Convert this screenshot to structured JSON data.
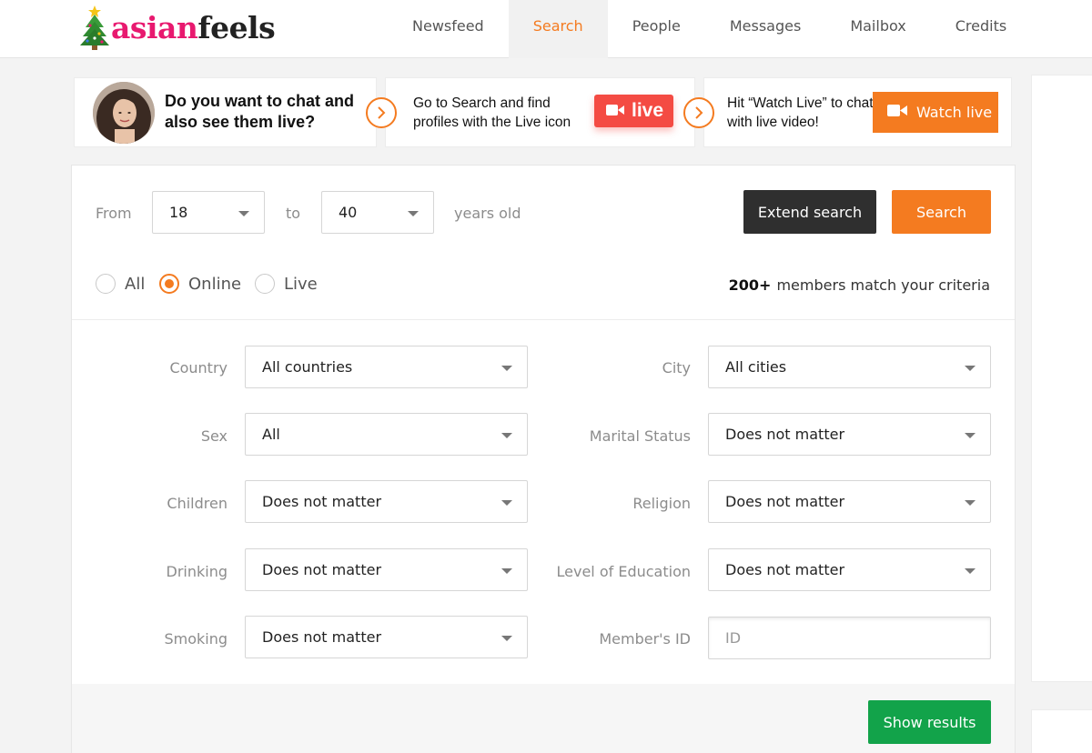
{
  "brand": {
    "name_part1": "asian",
    "name_part2": "feels"
  },
  "nav": {
    "items": [
      "Newsfeed",
      "Search",
      "People",
      "Messages",
      "Mailbox",
      "Credits"
    ],
    "active": "Search"
  },
  "promo": {
    "step1": "Do you want to chat and also see them live?",
    "step2": "Go to Search and find profiles with the Live icon",
    "live_label": "live",
    "step3": "Hit “Watch Live” to chat with live video!",
    "watch_label": "Watch live"
  },
  "search": {
    "from_label": "From",
    "age_from": "18",
    "to_label": "to",
    "age_to": "40",
    "years_label": "years old",
    "extend_button": "Extend search",
    "search_button": "Search",
    "filter_options": [
      "All",
      "Online",
      "Live"
    ],
    "filter_selected": "Online",
    "match_count": "200+",
    "match_text": "members match your criteria"
  },
  "filters": {
    "country": {
      "label": "Country",
      "value": "All countries"
    },
    "city": {
      "label": "City",
      "value": "All cities"
    },
    "sex": {
      "label": "Sex",
      "value": "All"
    },
    "marital": {
      "label": "Marital Status",
      "value": "Does not matter"
    },
    "children": {
      "label": "Children",
      "value": "Does not matter"
    },
    "religion": {
      "label": "Religion",
      "value": "Does not matter"
    },
    "drinking": {
      "label": "Drinking",
      "value": "Does not matter"
    },
    "education": {
      "label": "Level of Education",
      "value": "Does not matter"
    },
    "smoking": {
      "label": "Smoking",
      "value": "Does not matter"
    },
    "member_id": {
      "label": "Member's ID",
      "placeholder": "ID"
    }
  },
  "show_results": "Show results",
  "colors": {
    "accent": "#f47b20",
    "live": "#f44b43",
    "brand_pink": "#e8196f",
    "success": "#12a34a",
    "dark": "#2f2f2f"
  }
}
